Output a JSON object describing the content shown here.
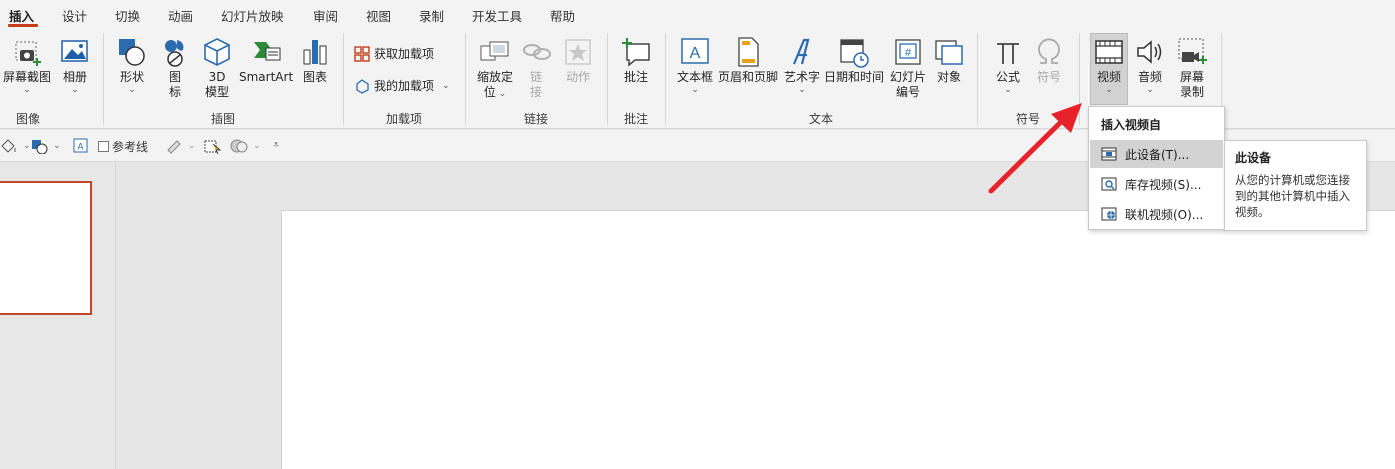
{
  "tabs": [
    {
      "label": "插入",
      "active": true
    },
    {
      "label": "设计"
    },
    {
      "label": "切换"
    },
    {
      "label": "动画"
    },
    {
      "label": "幻灯片放映"
    },
    {
      "label": "审阅"
    },
    {
      "label": "视图"
    },
    {
      "label": "录制"
    },
    {
      "label": "开发工具"
    },
    {
      "label": "帮助"
    }
  ],
  "ribbon": {
    "groups": {
      "images": "图像",
      "illustrations": "插图",
      "addins": "加载项",
      "links": "链接",
      "comments": "批注",
      "text": "文本",
      "symbols": "符号"
    },
    "screenshot": "屏幕截图",
    "album": "相册",
    "shapes": "形状",
    "icons_line1": "图",
    "icons_line2": "标",
    "model3d_line1": "3D",
    "model3d_line2": "模型",
    "smartart": "SmartArt",
    "chart": "图表",
    "get_addins": "获取加载项",
    "my_addins": "我的加载项",
    "zoom_line1": "缩放定",
    "zoom_line2": "位",
    "link_line1": "链",
    "link_line2": "接",
    "action": "动作",
    "comment": "批注",
    "textbox": "文本框",
    "header_footer": "页眉和页脚",
    "wordart": "艺术字",
    "datetime": "日期和时间",
    "slide_number_line1": "幻灯片",
    "slide_number_line2": "编号",
    "object": "对象",
    "equation": "公式",
    "symbol": "符号",
    "video": "视频",
    "audio": "音频",
    "screen_rec_line1": "屏幕",
    "screen_rec_line2": "录制"
  },
  "quickbar": {
    "guides": "参考线"
  },
  "dropdown": {
    "title": "插入视频自",
    "items": [
      {
        "label": "此设备(T)..."
      },
      {
        "label": "库存视频(S)..."
      },
      {
        "label": "联机视频(O)..."
      }
    ]
  },
  "tooltip": {
    "title": "此设备",
    "body": "从您的计算机或您连接到的其他计算机中插入视频。"
  },
  "colors": {
    "accent": "#c43e1c",
    "arrow": "#e8222b",
    "icon_blue": "#2b6cb0"
  }
}
